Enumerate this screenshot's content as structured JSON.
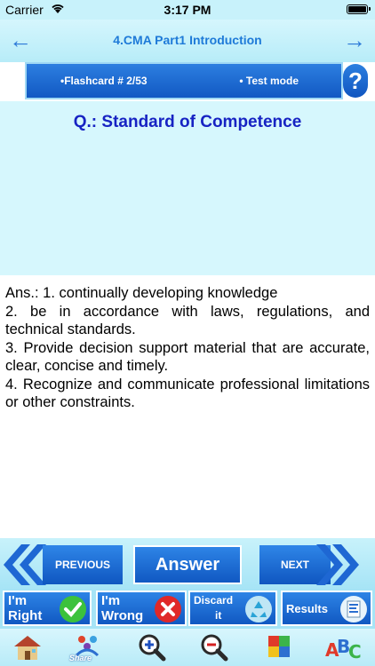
{
  "status": {
    "carrier": "Carrier",
    "time": "3:17 PM"
  },
  "nav": {
    "title": "4.CMA Part1 Introduction",
    "back_glyph": "←",
    "forward_glyph": "→"
  },
  "info": {
    "flashcard": "•Flashcard #  2/53",
    "mode": "• Test mode",
    "help": "?"
  },
  "question": {
    "text": "Q.: Standard of Competence"
  },
  "answer": {
    "text": "Ans.:   1. continually developing knowledge\n2. be in accordance with laws, regulations, and technical standards.\n3. Provide decision support material that are accurate, clear, concise and timely.\n4. Recognize and communicate professional limitations or other constraints."
  },
  "actions": {
    "previous": "PREVIOUS",
    "answer": "Answer",
    "next": "NEXT"
  },
  "tiles": {
    "right": {
      "line1": "I'm",
      "line2": "Right",
      "icon": "check-icon",
      "color": "#3cc23c"
    },
    "wrong": {
      "line1": "I'm",
      "line2": "Wrong",
      "icon": "cross-icon",
      "color": "#e02828"
    },
    "discard": {
      "line1": "Discard",
      "line2": "it",
      "icon": "recycle-icon",
      "color": "#bfe6f5"
    },
    "results": {
      "line1": "Results",
      "icon": "report-icon",
      "color": "#e8f4fb"
    }
  },
  "toolbar": {
    "share_label": "Share",
    "items": [
      "home-icon",
      "share-icon",
      "zoom-in-icon",
      "zoom-out-icon",
      "puzzle-icon",
      "abc-icon"
    ]
  }
}
